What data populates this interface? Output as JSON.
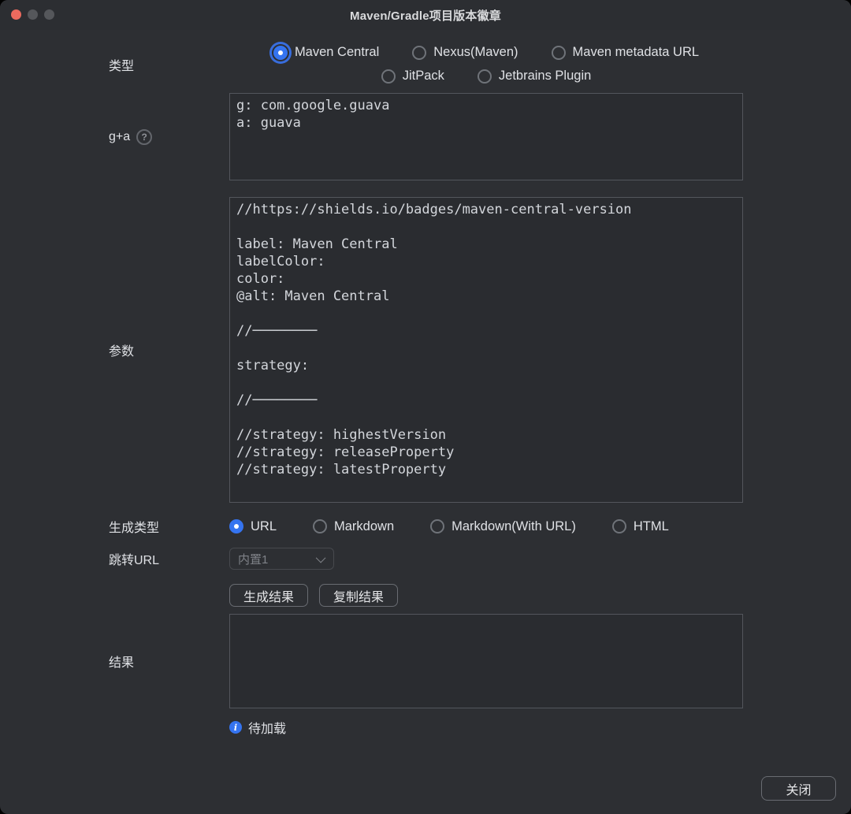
{
  "window": {
    "title": "Maven/Gradle项目版本徽章"
  },
  "colors": {
    "accent": "#3574F0",
    "traffic_red": "#EC6A5E",
    "traffic_gray": "#55575B",
    "window_bg": "#2D2F33",
    "field_border": "#53565C"
  },
  "form": {
    "type": {
      "label": "类型",
      "row1": [
        {
          "label": "Maven Central",
          "selected": true
        },
        {
          "label": "Nexus(Maven)",
          "selected": false
        },
        {
          "label": "Maven metadata URL",
          "selected": false
        }
      ],
      "row2": [
        {
          "label": "JitPack",
          "selected": false
        },
        {
          "label": "Jetbrains Plugin",
          "selected": false
        }
      ]
    },
    "ga": {
      "label": "g+a",
      "help_icon": "?",
      "value": "g: com.google.guava\na: guava"
    },
    "params": {
      "label": "参数",
      "value": "//https://shields.io/badges/maven-central-version\n\nlabel: Maven Central\nlabelColor:\ncolor:\n@alt: Maven Central\n\n//────────\n\nstrategy:\n\n//────────\n\n//strategy: highestVersion\n//strategy: releaseProperty\n//strategy: latestProperty"
    },
    "gen_type": {
      "label": "生成类型",
      "options": [
        {
          "label": "URL",
          "selected": true
        },
        {
          "label": "Markdown",
          "selected": false
        },
        {
          "label": "Markdown(With URL)",
          "selected": false
        },
        {
          "label": "HTML",
          "selected": false
        }
      ]
    },
    "jump_url": {
      "label": "跳转URL",
      "selected_option": "内置1"
    },
    "actions": {
      "generate_label": "生成结果",
      "copy_label": "复制结果"
    },
    "result": {
      "label": "结果",
      "value": ""
    },
    "status": {
      "icon": "i",
      "text": "待加载"
    },
    "footer": {
      "close_label": "关闭"
    }
  }
}
